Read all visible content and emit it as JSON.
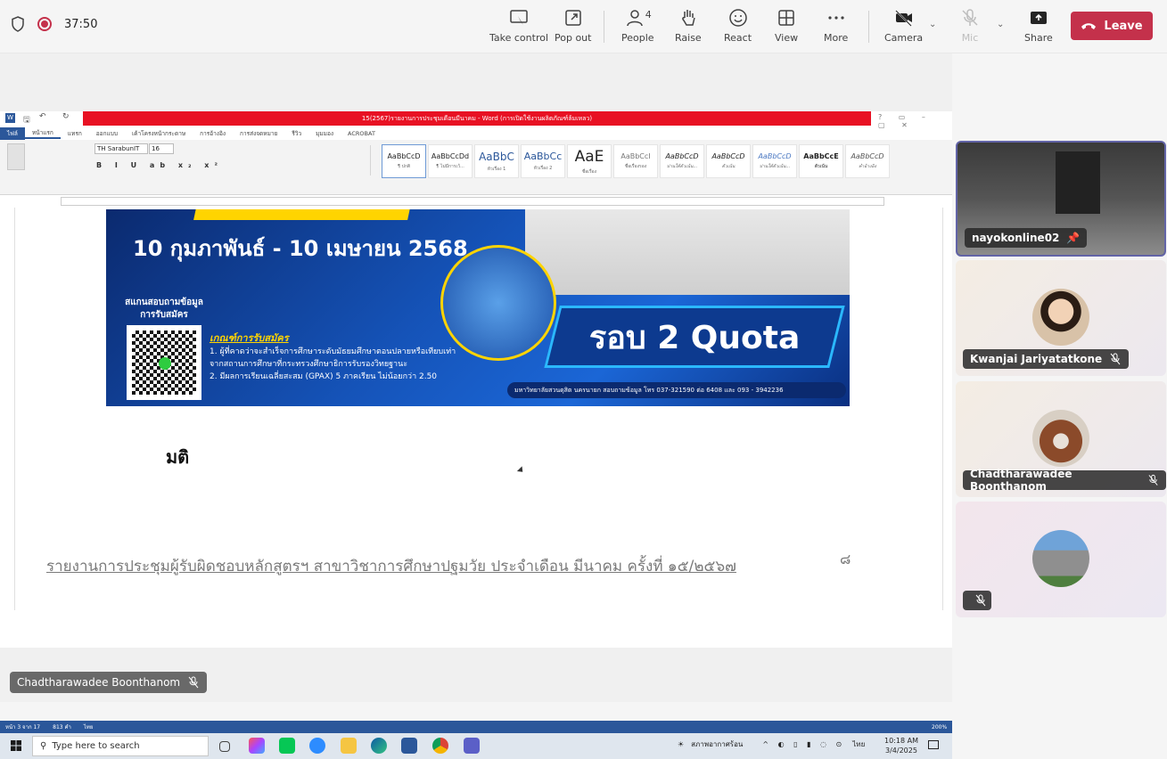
{
  "meeting": {
    "timer": "37:50",
    "toolbar": [
      {
        "id": "take-control",
        "label": "Take control",
        "icon": "take-control-icon"
      },
      {
        "id": "pop-out",
        "label": "Pop out",
        "icon": "pop-out-icon"
      },
      {
        "id": "people",
        "label": "People",
        "icon": "people-icon",
        "count": "4"
      },
      {
        "id": "raise",
        "label": "Raise",
        "icon": "hand-icon"
      },
      {
        "id": "react",
        "label": "React",
        "icon": "smiley-icon"
      },
      {
        "id": "view",
        "label": "View",
        "icon": "grid-icon"
      },
      {
        "id": "more",
        "label": "More",
        "icon": "ellipsis-icon"
      },
      {
        "id": "camera",
        "label": "Camera",
        "icon": "camera-off-icon"
      },
      {
        "id": "mic",
        "label": "Mic",
        "icon": "mic-off-icon"
      },
      {
        "id": "share",
        "label": "Share",
        "icon": "share-icon"
      }
    ],
    "leave_label": "Leave"
  },
  "word": {
    "title_bar": "15(2567)รายงานการประชุมเดือนมีนาคม - Word (การเปิดใช้งานผลิตภัณฑ์ล้มเหลว)",
    "tabs": [
      "ไฟล์",
      "หน้าแรก",
      "แทรก",
      "ออกแบบ",
      "เค้าโครงหน้ากระดาษ",
      "การอ้างอิง",
      "การส่งจดหมาย",
      "รีวิว",
      "มุมมอง",
      "ACROBAT"
    ],
    "font_name": "TH SarabunIT",
    "font_size": "16",
    "styles": [
      {
        "preview": "AaBbCcD",
        "name": "¶ ปกติ"
      },
      {
        "preview": "AaBbCcDd",
        "name": "¶ ไม่มีการเว้..."
      },
      {
        "preview": "AaBbC",
        "name": "หัวเรื่อง 1"
      },
      {
        "preview": "AaBbCc",
        "name": "หัวเรื่อง 2"
      },
      {
        "preview": "AaE",
        "name": "ชื่อเรื่อง"
      },
      {
        "preview": "AaBbCcI",
        "name": "ชื่อเรื่องรอง"
      },
      {
        "preview": "AaBbCcD",
        "name": "ปานใต้ตัวเน้น..."
      },
      {
        "preview": "AaBbCcD",
        "name": "ตัวเน้น"
      },
      {
        "preview": "AaBbCcD",
        "name": "ปานใต้ตัวเน้น..."
      },
      {
        "preview": "AaBbCcE",
        "name": "ตัวเน้น"
      },
      {
        "preview": "AaBbCcD",
        "name": "คำอ้างอิง"
      }
    ],
    "banner": {
      "date": "10 กุมภาพันธ์ - 10 เมษายน 2568",
      "scan": "สแกนสอบถามข้อมูล การรับสมัคร",
      "criteria_title": "เกณฑ์การรับสมัคร",
      "criteria_1": "1. ผู้ที่คาดว่าจะสำเร็จการศึกษาระดับมัธยมศึกษาตอนปลายหรือเทียบเท่าจากสถานการศึกษาที่กระทรวงศึกษาธิการรับรองวิทยฐานะ",
      "criteria_2": "2. มีผลการเรียนเฉลี่ยสะสม (GPAX) 5 ภาคเรียน ไม่น้อยกว่า 2.50",
      "quota": "รอบ 2 Quota",
      "contact": "มหาวิทยาลัยสวนดุสิต นครนายก   สอบถามข้อมูล โทร 037-321590 ต่อ 6408 และ 093 - 3942236"
    },
    "body_text": "มติ",
    "footer": "รายงานการประชุมผู้รับผิดชอบหลักสูตรฯ สาขาวิชาการศึกษาปฐมวัย ประจำเดือน มีนาคม ครั้งที่ ๑๕/๒๕๖๗",
    "page_number": "๘",
    "status_page": "หน้า 3 จาก 17",
    "status_words": "813 คำ",
    "status_lang": "ไทย",
    "zoom": "200%"
  },
  "taskbar": {
    "search_placeholder": "Type here to search",
    "weather": "สภาพอากาศร้อน",
    "lang": "ไทย",
    "time": "10:18 AM",
    "date": "3/4/2025"
  },
  "participants": [
    {
      "name": "nayokonline02",
      "pinned": true
    },
    {
      "name": "Kwanjai Jariyatatkone",
      "muted": true
    },
    {
      "name": "Chadtharawadee Boonthanom",
      "muted": true
    },
    {
      "name": "",
      "muted": true
    }
  ],
  "presenter_name": "Chadtharawadee Boonthanom",
  "colors": {
    "leave": "#c4314b",
    "word": "#2b579a",
    "accent": "#6264a7"
  }
}
